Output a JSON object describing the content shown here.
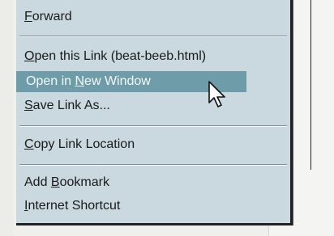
{
  "menu": {
    "items": [
      {
        "label": "Forward",
        "accel": "F"
      },
      {
        "label": "Open this Link (beat-beeb.html)",
        "accel": "O"
      },
      {
        "label": "Open in New Window",
        "accel": "N",
        "highlighted": true
      },
      {
        "label": "Save Link As...",
        "accel": "S"
      },
      {
        "label": "Copy Link Location",
        "accel": "C"
      },
      {
        "label": "Add Bookmark",
        "accel": "B"
      },
      {
        "label": "Internet Shortcut",
        "accel": "I"
      }
    ],
    "highlight_color": "#6f9ca9",
    "background_color": "#c9d9df"
  },
  "icons": {
    "cursor": "arrow-pointer-icon"
  }
}
